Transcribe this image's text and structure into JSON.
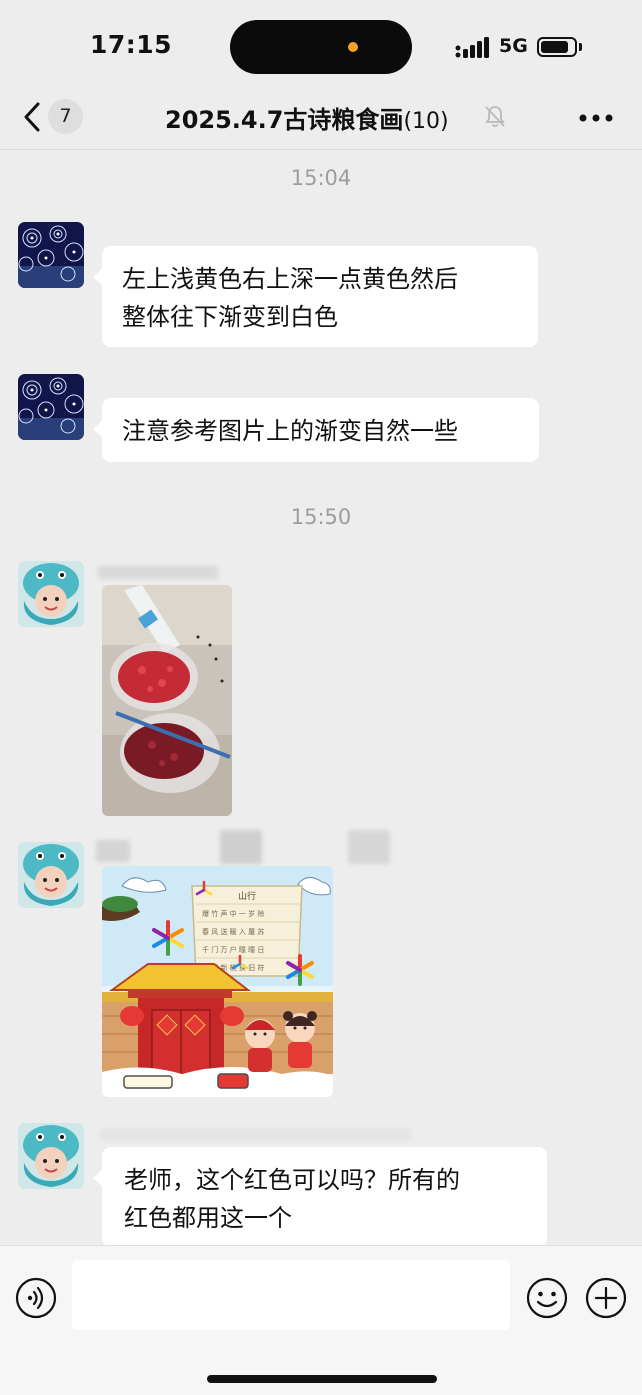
{
  "status_bar": {
    "time": "17:15",
    "network": "5G",
    "indicator_color": "#f0a326"
  },
  "nav": {
    "unread_count": "7",
    "title": "2025.4.7古诗粮食画",
    "member_count": "(10)",
    "icons": [
      "chevron-left-icon",
      "bell-muted-icon",
      "more-icon"
    ]
  },
  "messages": {
    "time_1": "15:04",
    "msg_1_line1": "左上浅黄色右上深一点黄色然后",
    "msg_1_line2": "整体往下渐变到白色",
    "msg_2": "注意参考图片上的渐变自然一些",
    "time_2": "15:50",
    "photo_bottle_label": "bottle",
    "poem_title": "山行",
    "poem_text": "爆竹声中一岁除，春风送暖入屠苏。千门万户曈曈日，总把新桃换旧符。",
    "msg_3_line1": "老师，这个红色可以吗？所有的",
    "msg_3_line2": "红色都用这一个"
  },
  "input_bar": {
    "placeholder": "",
    "icons": [
      "voice-icon",
      "emoji-icon",
      "plus-icon"
    ]
  },
  "colors": {
    "background": "#ededed",
    "bubble": "#ffffff",
    "input_bar": "#f6f6f6"
  }
}
